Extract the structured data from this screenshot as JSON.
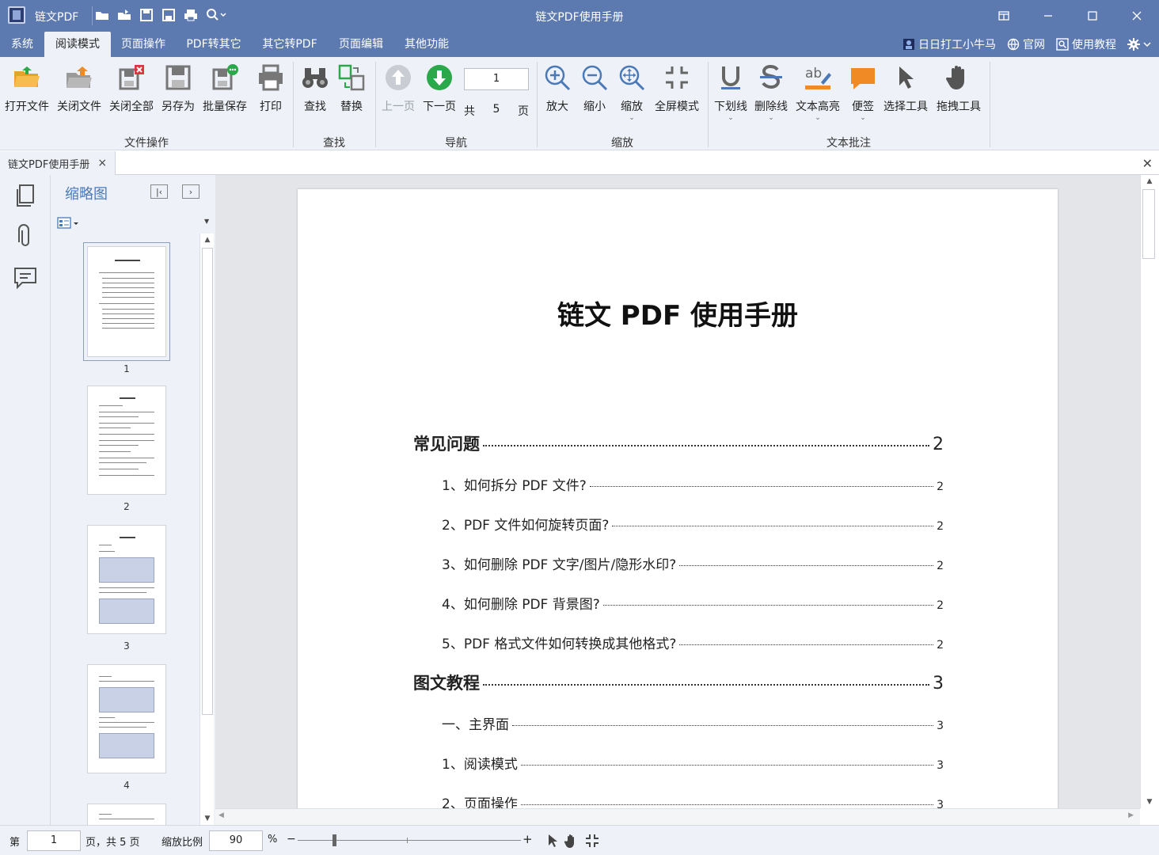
{
  "app": {
    "name": "链文PDF",
    "window_title": "链文PDF使用手册"
  },
  "menu": {
    "items": [
      "系统",
      "阅读模式",
      "页面操作",
      "PDF转其它",
      "其它转PDF",
      "页面编辑",
      "其他功能"
    ],
    "active": "阅读模式",
    "right": {
      "user": "日日打工小牛马",
      "website": "官网",
      "tutorial": "使用教程"
    }
  },
  "ribbon": {
    "file_ops": {
      "group_label": "文件操作",
      "open": "打开文件",
      "close": "关闭文件",
      "close_all": "关闭全部",
      "save_as": "另存为",
      "batch_save": "批量保存",
      "print": "打印"
    },
    "find": {
      "group_label": "查找",
      "find": "查找",
      "replace": "替换"
    },
    "nav": {
      "group_label": "导航",
      "prev": "上一页",
      "next": "下一页",
      "current_page": "1",
      "total_prefix": "共",
      "total": "5",
      "total_suffix": "页"
    },
    "zoom": {
      "group_label": "缩放",
      "zoom_in": "放大",
      "zoom_out": "缩小",
      "zoom": "缩放",
      "fullscreen": "全屏模式"
    },
    "annot": {
      "group_label": "文本批注",
      "underline": "下划线",
      "strikethrough": "删除线",
      "highlight": "文本高亮",
      "note": "便签",
      "select": "选择工具",
      "drag": "拖拽工具"
    }
  },
  "tab": {
    "title": "链文PDF使用手册"
  },
  "thumbnails": {
    "title": "缩略图",
    "pages": [
      "1",
      "2",
      "3",
      "4"
    ]
  },
  "document": {
    "title": "链文 PDF 使用手册",
    "toc": [
      {
        "level": 1,
        "text": "常见问题",
        "page": "2"
      },
      {
        "level": 2,
        "text": "1、如何拆分 PDF 文件?",
        "page": "2"
      },
      {
        "level": 2,
        "text": "2、PDF 文件如何旋转页面?",
        "page": "2"
      },
      {
        "level": 2,
        "text": "3、如何删除 PDF 文字/图片/隐形水印?",
        "page": "2"
      },
      {
        "level": 2,
        "text": "4、如何删除 PDF 背景图?",
        "page": "2"
      },
      {
        "level": 2,
        "text": "5、PDF 格式文件如何转换成其他格式?",
        "page": "2"
      },
      {
        "level": 1,
        "text": "图文教程",
        "page": "3"
      },
      {
        "level": 2,
        "text": "一、主界面",
        "page": "3"
      },
      {
        "level": 2,
        "text": "1、阅读模式",
        "page": "3"
      },
      {
        "level": 2,
        "text": "2、页面操作",
        "page": "3"
      }
    ]
  },
  "status": {
    "page_prefix": "第",
    "page_value": "1",
    "page_suffix": "页，共 5 页",
    "zoom_label": "缩放比例",
    "zoom_value": "90",
    "zoom_unit": "%",
    "zoom_minus": "−",
    "zoom_plus": "+"
  },
  "colors": {
    "titlebar": "#5d7ab0",
    "ribbon": "#eef1f7",
    "accent_green": "#2aa84a",
    "accent_orange": "#f08a24",
    "link_blue": "#4a79b8"
  }
}
